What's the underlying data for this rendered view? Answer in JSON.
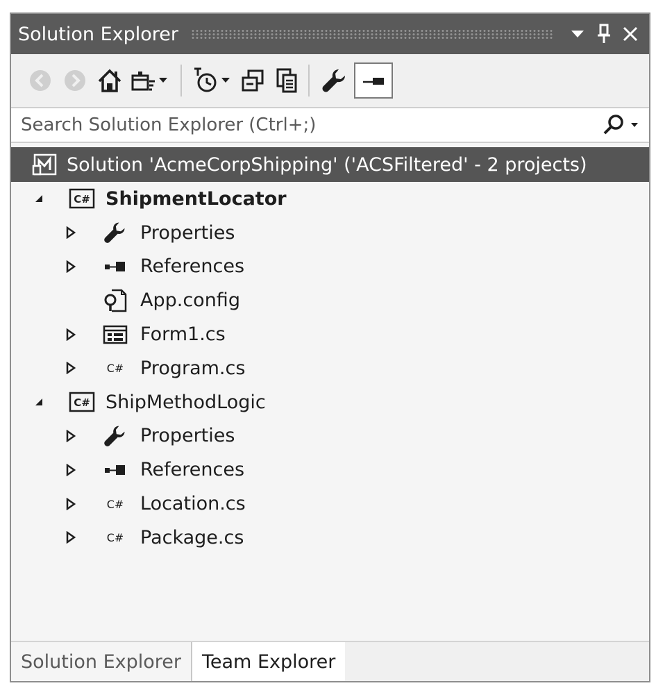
{
  "window": {
    "title": "Solution Explorer"
  },
  "toolbar": {
    "buttons": [
      {
        "icon": "back-circle-icon"
      },
      {
        "icon": "forward-circle-icon"
      },
      {
        "icon": "home-icon"
      },
      {
        "icon": "sync-view-icon"
      },
      {
        "icon": "pending-changes-icon"
      },
      {
        "icon": "collapse-all-icon"
      },
      {
        "icon": "show-all-files-icon"
      },
      {
        "icon": "wrench-icon"
      },
      {
        "icon": "preview-icon"
      }
    ]
  },
  "search": {
    "placeholder": "Search Solution Explorer (Ctrl+;)"
  },
  "solution": {
    "label": "Solution 'AcmeCorpShipping' ('ACSFiltered' - 2 projects)"
  },
  "tree": {
    "project1": {
      "name": "ShipmentLocator",
      "items": [
        "Properties",
        "References",
        "App.config",
        "Form1.cs",
        "Program.cs"
      ]
    },
    "project2": {
      "name": "ShipMethodLogic",
      "items": [
        "Properties",
        "References",
        "Location.cs",
        "Package.cs"
      ]
    }
  },
  "tabs": {
    "solution_explorer": "Solution Explorer",
    "team_explorer": "Team Explorer"
  },
  "colors": {
    "titlebar": "#5a5a5a",
    "selection": "#555555",
    "panel": "#f5f5f5"
  }
}
